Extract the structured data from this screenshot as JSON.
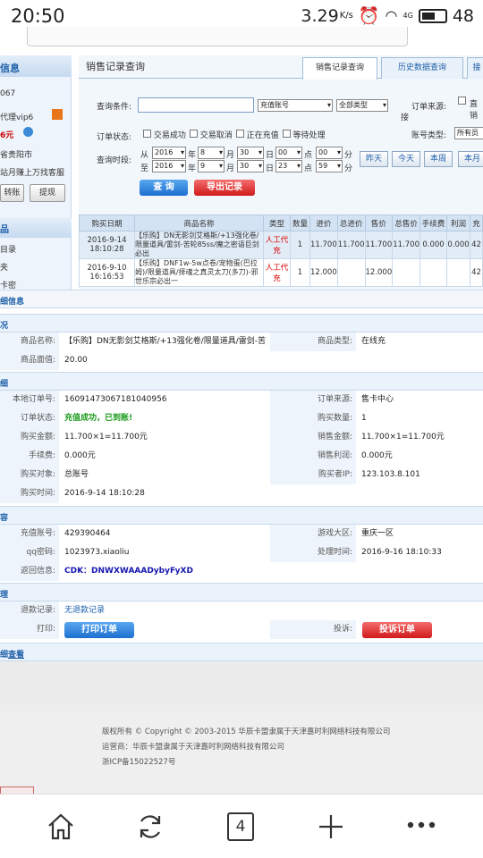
{
  "status": {
    "time": "20:50",
    "speed": "3.29",
    "speed_unit": "K/s",
    "net": "4G",
    "battery": "48"
  },
  "left": {
    "title": "信息",
    "items": [
      "067",
      "代理vip6",
      "6元",
      "省贵阳市",
      "站月赚上万找客服"
    ],
    "btn_transfer": "转账",
    "btn_withdraw": "提现",
    "title2": "品",
    "menu": [
      "目录",
      "夹",
      "卡密"
    ]
  },
  "tabs": [
    "销售记录查询",
    "历史数据查询",
    "接"
  ],
  "page_title": "销售记录查询",
  "filters": {
    "cond_label": "查询条件:",
    "cond_value": "",
    "account_type": "充值账号",
    "all_type": "全部类型",
    "order_source_label": "订单来源:",
    "direct_label": "直销",
    "direct_suffix": "接",
    "order_status_label": "订单状态:",
    "status_opts": [
      "交易成功",
      "交易取消",
      "正在充值",
      "等待处理"
    ],
    "account_cat_label": "账号类型:",
    "account_cat_value": "所有员",
    "period_label": "查询时段:",
    "from": "从",
    "to": "至",
    "from_vals": [
      "2016",
      "8",
      "30",
      "00",
      "00"
    ],
    "to_vals": [
      "2016",
      "9",
      "30",
      "23",
      "59"
    ],
    "units": [
      "年",
      "月",
      "日",
      "点",
      "分"
    ],
    "quick": [
      "昨天",
      "今天",
      "本周",
      "本月"
    ],
    "btn_query": "查 询",
    "btn_export": "导出记录"
  },
  "table": {
    "headers": [
      "购买日期",
      "商品名称",
      "类型",
      "数量",
      "进价",
      "总进价",
      "售价",
      "总售价",
      "手续费",
      "利润",
      "充"
    ],
    "rows": [
      {
        "date": "2016-9-14 18:10:28",
        "name": "【乐购】DN无影剑艾格斯/+13强化卷/限量道具/雷剑-苦轮85ss/魔之密语巨剑必出",
        "type": "人工代充",
        "qty": "1",
        "cost": "11.700",
        "tcost": "11.700",
        "price": "11.700",
        "tprice": "11.700",
        "fee": "0.000",
        "profit": "0.000",
        "c": "42"
      },
      {
        "date": "2016-9-10 16:16:53",
        "name": "【乐购】DNF1w-5w点卷/宠物蛋(巴拉姆)/限量道具/择魂之真灵太刀(多刀)-邪世乐宗必出一",
        "type": "人工代充",
        "qty": "1",
        "cost": "12.000",
        "tcost": "",
        "price": "12.000",
        "tprice": "",
        "fee": "",
        "profit": "",
        "c": "42"
      }
    ]
  },
  "detail": {
    "title": "细信息",
    "sec1": "况",
    "product_name_k": "商品名称:",
    "product_name_v": "【乐购】DN无影剑艾格斯/+13强化卷/限量道具/雷剑-苦",
    "product_type_k": "商品类型:",
    "product_type_v": "在线充",
    "face_k": "商品面值:",
    "face_v": "20.00",
    "sec2": "细",
    "order_no_k": "本地订单号:",
    "order_no_v": "16091473067181040956",
    "source_k": "订单来源:",
    "source_v": "售卡中心",
    "status_k": "订单状态:",
    "status_v": "充值成功，已到账!",
    "qty_k": "购买数量:",
    "qty_v": "1",
    "amount_k": "购买金额:",
    "amount_v": "11.700×1=11.700元",
    "sale_k": "销售金额:",
    "sale_v": "11.700×1=11.700元",
    "fee_k": "手续费:",
    "fee_v": "0.000元",
    "profit_k": "销售利润:",
    "profit_v": "0.000元",
    "target_k": "购买对象:",
    "target_v": "总账号",
    "ip_k": "购买者IP:",
    "ip_v": "123.103.8.101",
    "time_k": "购买时间:",
    "time_v": "2016-9-14 18:10:28",
    "sec3": "容",
    "acct_k": "充值账号:",
    "acct_v": "429390464",
    "region_k": "游戏大区:",
    "region_v": "重庆一区",
    "pwd_k": "qq密码:",
    "pwd_v": "1023973.xiaoliu",
    "ptime_k": "处理时间:",
    "ptime_v": "2016-9-16 18:10:33",
    "ret_k": "返回信息:",
    "ret_v": "CDK：DNWXWAAADybyFyXD",
    "sec4": "理",
    "refund_k": "退款记录:",
    "refund_v": "无退款记录",
    "print_k": "打印:",
    "print_btn": "打印订单",
    "complain_k": "投诉:",
    "complain_btn": "投诉订单",
    "bottom_a": "细",
    "bottom_b": "查看"
  },
  "footer": {
    "line1": "版权所有 © Copyright © 2003-2015 华辰卡盟隶属于天津嘉时利网络科技有限公司",
    "line2": "运营商：华辰卡盟隶属于天津嘉时利网络科技有限公司",
    "line3": "浙ICP备15022527号"
  },
  "nav": {
    "tabs_count": "4"
  }
}
